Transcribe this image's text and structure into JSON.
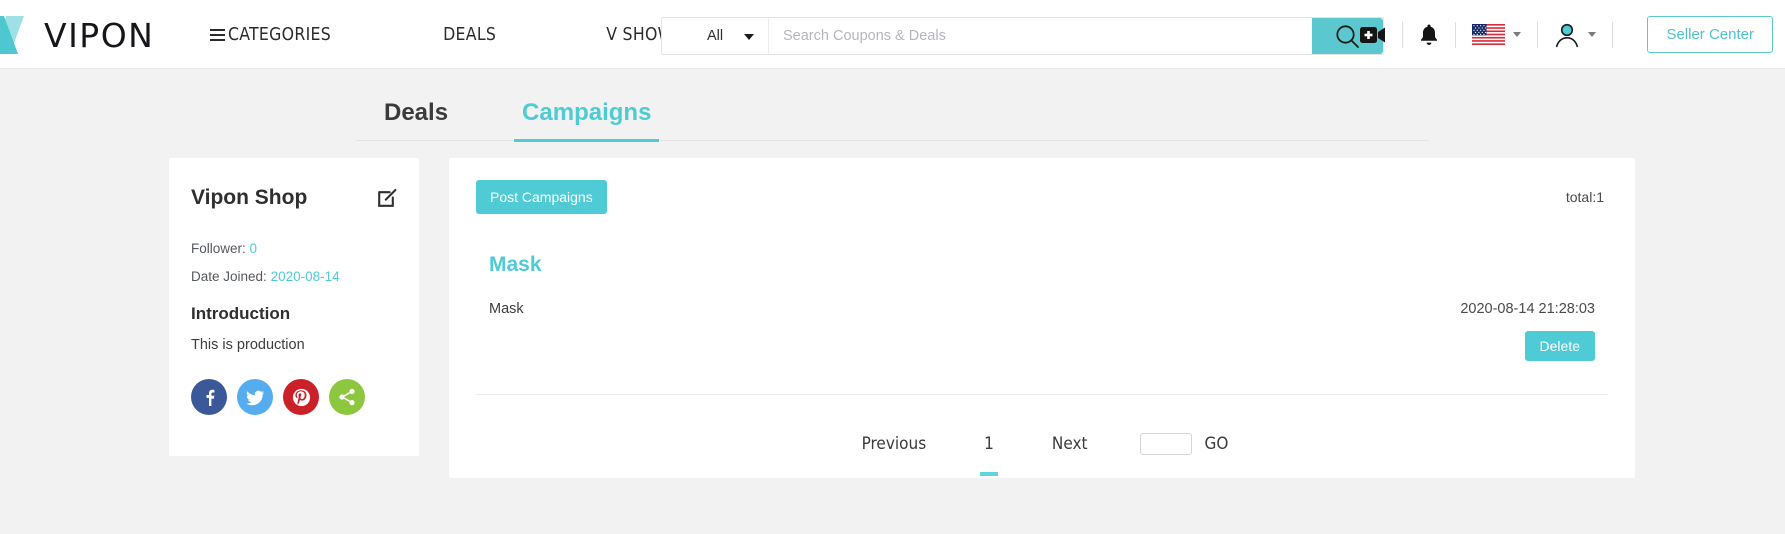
{
  "header": {
    "logo_text": "VIPON",
    "nav": [
      {
        "label": "CATEGORIES",
        "icon": "hamburger-icon"
      },
      {
        "label": "DEALS",
        "icon": null
      },
      {
        "label": "V SHOW",
        "icon": null
      }
    ],
    "search": {
      "category_label": "All",
      "placeholder": "Search Coupons & Deals",
      "value": "",
      "search_icon": "magnifier-icon"
    },
    "icons": [
      {
        "name": "video-add-icon",
        "glyph": "video"
      },
      {
        "name": "notification-bell-icon",
        "glyph": "bell"
      },
      {
        "name": "flag-us-icon",
        "glyph": "flag-us"
      },
      {
        "name": "user-avatar-icon",
        "glyph": "avatar"
      }
    ],
    "seller_center_label": "Seller Center",
    "accent_color": "#4ecbd4",
    "search_button_color": "#5bc8cf"
  },
  "tabs": [
    {
      "label": "Deals",
      "active": false
    },
    {
      "label": "Campaigns",
      "active": true
    }
  ],
  "sidebar": {
    "shop_name": "Vipon Shop",
    "edit_icon": "edit-square-icon",
    "follower_label": "Follower:",
    "follower_value": "0",
    "date_joined_label": "Date Joined:",
    "date_joined_value": "2020-08-14",
    "introduction_title": "Introduction",
    "introduction_body": "This is production",
    "socials": [
      {
        "name": "facebook-icon",
        "color": "#3b5998",
        "glyph": "f"
      },
      {
        "name": "twitter-icon",
        "color": "#55acee",
        "glyph": "t"
      },
      {
        "name": "pinterest-icon",
        "color": "#cb2027",
        "glyph": "p"
      },
      {
        "name": "share-icon",
        "color": "#8dc63f",
        "glyph": "s"
      }
    ]
  },
  "main": {
    "post_button_label": "Post Campaigns",
    "total_label": "total:1",
    "campaign": {
      "title": "Mask",
      "description": "Mask",
      "date": "2020-08-14 21:28:03",
      "delete_label": "Delete"
    },
    "pagination": {
      "previous_label": "Previous",
      "page_number": "1",
      "next_label": "Next",
      "goto_value": "",
      "goto_placeholder": "",
      "go_label": "GO"
    }
  }
}
